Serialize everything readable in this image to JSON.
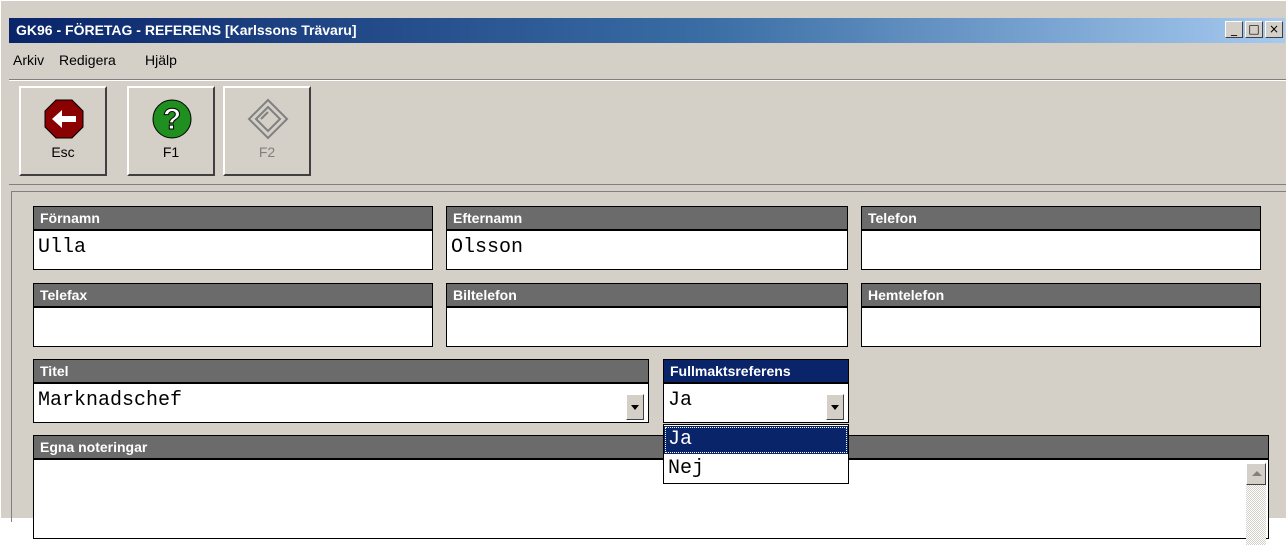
{
  "window": {
    "title": "GK96 - FÖRETAG - REFERENS [Karlssons Trävaru]",
    "controls": {
      "minimize": "_",
      "maximize": "□",
      "close": "×"
    }
  },
  "menu": [
    {
      "label": "Arkiv"
    },
    {
      "label": "Redigera"
    },
    {
      "label": "Hjälp"
    }
  ],
  "toolbar": {
    "buttons": [
      {
        "label": "Esc",
        "icon": "stop-arrow-icon",
        "enabled": true
      },
      {
        "label": "F1",
        "icon": "help-icon",
        "enabled": true
      },
      {
        "label": "F2",
        "icon": "save-disk-icon",
        "enabled": false
      }
    ]
  },
  "form": {
    "fornamn": {
      "label": "Förnamn",
      "value": "Ulla"
    },
    "efternamn": {
      "label": "Efternamn",
      "value": "Olsson"
    },
    "telefon": {
      "label": "Telefon",
      "value": ""
    },
    "telefax": {
      "label": "Telefax",
      "value": ""
    },
    "biltelefon": {
      "label": "Biltelefon",
      "value": ""
    },
    "hemtelefon": {
      "label": "Hemtelefon",
      "value": ""
    },
    "titel": {
      "label": "Titel",
      "value": "Marknadschef"
    },
    "fullmaktsreferens": {
      "label": "Fullmaktsreferens",
      "value": "Ja",
      "options": [
        "Ja",
        "Nej"
      ],
      "selected_option": "Ja"
    },
    "notes": {
      "label": "Egna noteringar",
      "value": ""
    }
  },
  "colors": {
    "title_bar_start": "#0a246a",
    "title_bar_end": "#a6caf0",
    "field_label_bg": "#6b6b6b",
    "active_label_bg": "#0a246a",
    "window_bg": "#d4d0c8"
  }
}
